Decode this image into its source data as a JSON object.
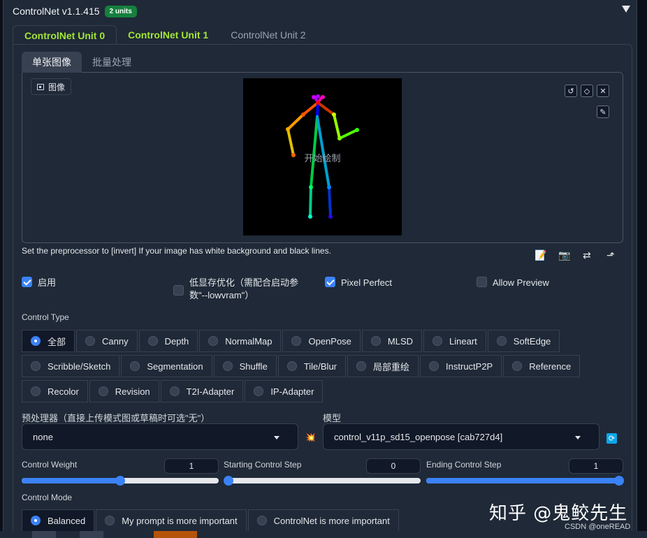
{
  "header": {
    "title": "ControlNet v1.1.415",
    "badge": "2 units"
  },
  "unit_tabs": [
    "ControlNet Unit 0",
    "ControlNet Unit 1",
    "ControlNet Unit 2"
  ],
  "image_tabs": [
    "单张图像",
    "批量处理"
  ],
  "image_label": "图像",
  "canvas_text": "开始绘制",
  "hint": "Set the preprocessor to [invert] If your image has white background and black lines.",
  "options": {
    "enable": "启用",
    "low_vram": "低显存优化（需配合启动参数\"--lowvram\"）",
    "pixel_perfect": "Pixel Perfect",
    "allow_preview": "Allow Preview"
  },
  "control_type": {
    "label": "Control Type",
    "items": [
      "全部",
      "Canny",
      "Depth",
      "NormalMap",
      "OpenPose",
      "MLSD",
      "Lineart",
      "SoftEdge",
      "Scribble/Sketch",
      "Segmentation",
      "Shuffle",
      "Tile/Blur",
      "局部重绘",
      "InstructP2P",
      "Reference",
      "Recolor",
      "Revision",
      "T2I-Adapter",
      "IP-Adapter"
    ],
    "selected": "全部"
  },
  "preprocessor": {
    "label": "预处理器（直接上传模式图或草稿时可选\"无\"）",
    "value": "none"
  },
  "model": {
    "label": "模型",
    "value": "control_v11p_sd15_openpose [cab727d4]"
  },
  "control_weight": {
    "label": "Control Weight",
    "value": "1",
    "fraction": 0.5
  },
  "starting_step": {
    "label": "Starting Control Step",
    "value": "0",
    "fraction": 0.0
  },
  "ending_step": {
    "label": "Ending Control Step",
    "value": "1",
    "fraction": 1.0
  },
  "control_mode": {
    "label": "Control Mode",
    "items": [
      "Balanced",
      "My prompt is more important",
      "ControlNet is more important"
    ],
    "selected": "Balanced"
  },
  "watermark": "知乎 @鬼鲛先生",
  "csdn": "CSDN @oneREAD",
  "colors": {
    "accent": "#3b82f6",
    "tab_active": "#a3e635",
    "badge": "#15803d"
  }
}
